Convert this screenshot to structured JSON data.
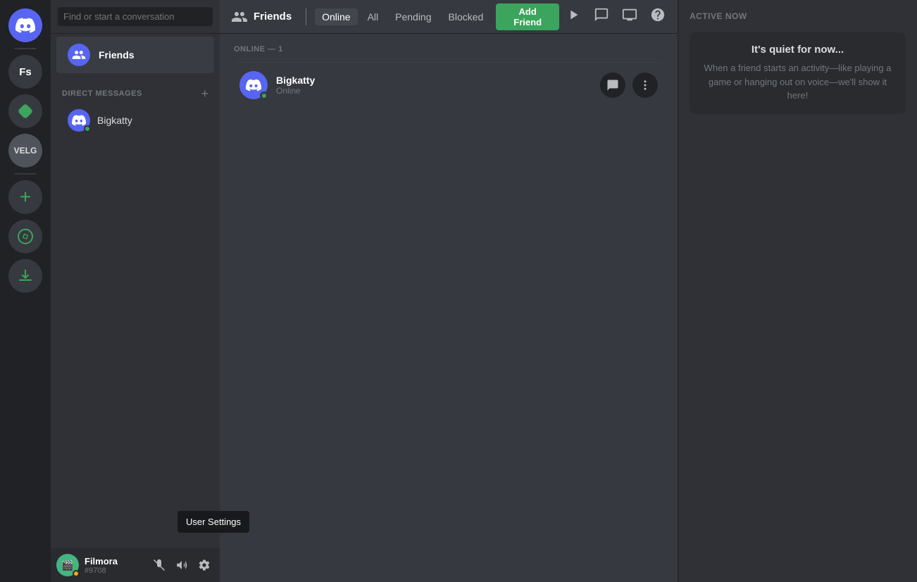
{
  "server_sidebar": {
    "discord_home_label": "Discord",
    "servers": [
      {
        "id": "fs",
        "label": "Fs",
        "type": "text"
      },
      {
        "id": "green-diamond",
        "label": "◆",
        "type": "diamond"
      },
      {
        "id": "velg",
        "label": "VELG",
        "type": "text"
      },
      {
        "id": "add",
        "label": "+",
        "type": "add"
      },
      {
        "id": "compass",
        "label": "⬤",
        "type": "compass"
      },
      {
        "id": "download",
        "label": "⬇",
        "type": "download"
      }
    ]
  },
  "dm_sidebar": {
    "search_placeholder": "Find or start a conversation",
    "friends_label": "Friends",
    "direct_messages_label": "Direct Messages",
    "dm_users": [
      {
        "id": "bigkatty",
        "name": "Bigkatty",
        "status": "online"
      }
    ]
  },
  "user_panel": {
    "name": "Filmora",
    "discriminator": "#9708",
    "status": "idle",
    "tooltip": "User Settings"
  },
  "top_nav": {
    "friends_label": "Friends",
    "tabs": [
      {
        "id": "online",
        "label": "Online",
        "active": true
      },
      {
        "id": "all",
        "label": "All",
        "active": false
      },
      {
        "id": "pending",
        "label": "Pending",
        "active": false
      },
      {
        "id": "blocked",
        "label": "Blocked",
        "active": false
      }
    ],
    "add_friend_label": "Add Friend"
  },
  "friends_list": {
    "online_header": "ONLINE — 1",
    "friends": [
      {
        "id": "bigkatty",
        "name": "Bigkatty",
        "status": "Online"
      }
    ]
  },
  "active_now": {
    "title": "ACTIVE NOW",
    "quiet_title": "It's quiet for now...",
    "quiet_desc": "When a friend starts an activity—like playing a game or hanging out on voice—we'll show it here!"
  }
}
